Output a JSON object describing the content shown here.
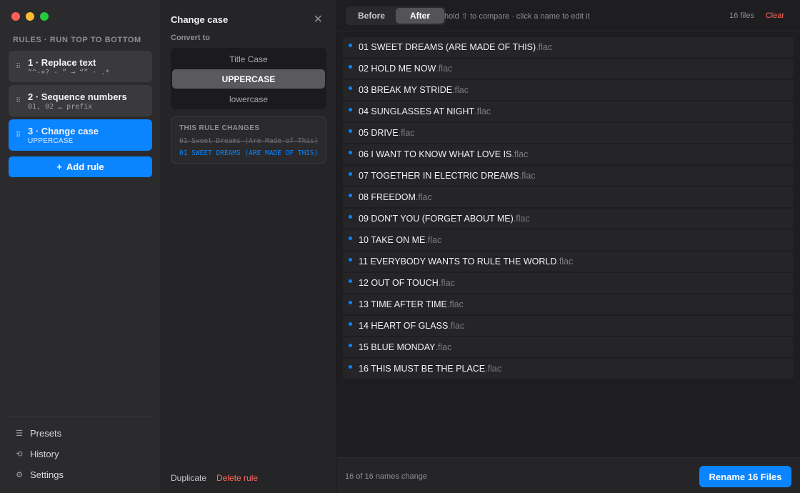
{
  "sidebar": {
    "heading": "RULES · RUN TOP TO BOTTOM",
    "rules": [
      {
        "title": "1 · Replace text",
        "subtitle": "“^-+? - ” → “” · .*"
      },
      {
        "title": "2 · Sequence numbers",
        "subtitle": "01, 02 … prefix"
      },
      {
        "title": "3 · Change case",
        "subtitle": "UPPERCASE"
      }
    ],
    "add_rule_label": "Add rule",
    "add_rule_icon": "+",
    "nav": [
      {
        "label": "Presets",
        "icon": "list-icon"
      },
      {
        "label": "History",
        "icon": "history-icon"
      },
      {
        "label": "Settings",
        "icon": "gear-icon"
      }
    ]
  },
  "inspector": {
    "title": "Change case",
    "convert_label": "Convert to",
    "options": [
      "Title Case",
      "UPPERCASE",
      "lowercase"
    ],
    "selected_option": "UPPERCASE",
    "preview_heading": "THIS RULE CHANGES",
    "preview_old": "01 Sweet Dreams (Are Made of This)",
    "preview_new": "01 SWEET DREAMS (ARE MADE OF THIS)",
    "duplicate_label": "Duplicate",
    "delete_label": "Delete rule"
  },
  "main": {
    "toggle": {
      "before": "Before",
      "after": "After",
      "selected": "After"
    },
    "hint": "hold ⇧ to compare · click a name to edit it",
    "file_count": "16 files",
    "clear_label": "Clear",
    "files": [
      {
        "name": "01 SWEET DREAMS (ARE MADE OF THIS)",
        "ext": ".flac"
      },
      {
        "name": "02 HOLD ME NOW",
        "ext": ".flac"
      },
      {
        "name": "03 BREAK MY STRIDE",
        "ext": ".flac"
      },
      {
        "name": "04 SUNGLASSES AT NIGHT",
        "ext": ".flac"
      },
      {
        "name": "05 DRIVE",
        "ext": ".flac"
      },
      {
        "name": "06 I WANT TO KNOW WHAT LOVE IS",
        "ext": ".flac"
      },
      {
        "name": "07 TOGETHER IN ELECTRIC DREAMS",
        "ext": ".flac"
      },
      {
        "name": "08 FREEDOM",
        "ext": ".flac"
      },
      {
        "name": "09 DON'T YOU (FORGET ABOUT ME)",
        "ext": ".flac"
      },
      {
        "name": "10 TAKE ON ME",
        "ext": ".flac"
      },
      {
        "name": "11 EVERYBODY WANTS TO RULE THE WORLD",
        "ext": ".flac"
      },
      {
        "name": "12 OUT OF TOUCH",
        "ext": ".flac"
      },
      {
        "name": "13 TIME AFTER TIME",
        "ext": ".flac"
      },
      {
        "name": "14 HEART OF GLASS",
        "ext": ".flac"
      },
      {
        "name": "15 BLUE MONDAY",
        "ext": ".flac"
      },
      {
        "name": "16 THIS MUST BE THE PLACE",
        "ext": ".flac"
      }
    ],
    "status_text": "16 of 16 names change",
    "rename_label": "Rename 16 Files"
  },
  "colors": {
    "accent": "#0a84ff",
    "danger": "#ff6b5e",
    "sidebar_bg": "#2b2b2e",
    "main_bg": "#1e1e20"
  }
}
